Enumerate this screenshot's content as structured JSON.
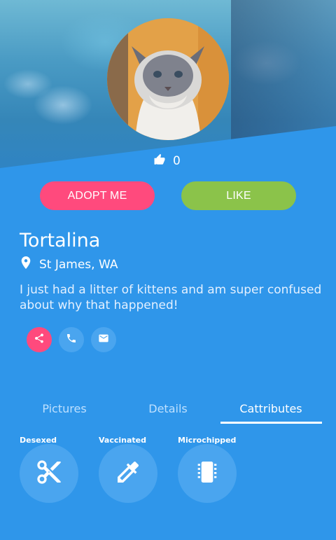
{
  "profile": {
    "likes_count": "0",
    "adopt_label": "ADOPT ME",
    "like_label": "LIKE",
    "name": "Tortalina",
    "location": "St James, WA",
    "bio": "I just had a litter of kittens and am super confused about why that happened!"
  },
  "actions": [
    {
      "icon": "share-icon"
    },
    {
      "icon": "phone-icon"
    },
    {
      "icon": "mail-icon"
    }
  ],
  "tabs": [
    {
      "label": "Pictures",
      "active": false
    },
    {
      "label": "Details",
      "active": false
    },
    {
      "label": "Cattributes",
      "active": true
    }
  ],
  "cattributes": [
    {
      "label": "Desexed",
      "icon": "scissors-icon"
    },
    {
      "label": "Vaccinated",
      "icon": "dropper-icon"
    },
    {
      "label": "Microchipped",
      "icon": "chip-icon"
    }
  ],
  "colors": {
    "background": "#2f96ea",
    "adopt_button": "#ff4a7d",
    "like_button": "#8bc34a",
    "icon_circle": "#4aa5ef"
  }
}
